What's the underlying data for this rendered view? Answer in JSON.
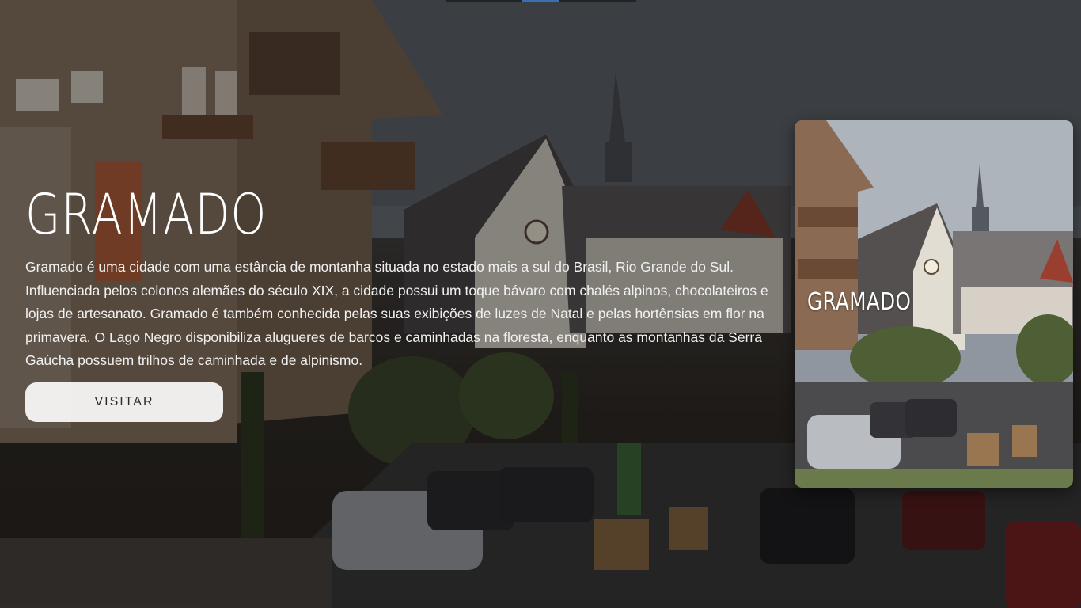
{
  "hero": {
    "title": "GRAMADO",
    "description": "Gramado é uma cidade com uma estância de montanha situada no estado mais a sul do Brasil, Rio Grande do Sul. Influenciada pelos colonos alemães do século XIX, a cidade possui um toque bávaro com chalés alpinos, chocolateiros e lojas de artesanato. Gramado é também conhecida pelas suas exibições de luzes de Natal e pelas hortênsias em flor na primavera. O Lago Negro disponibiliza alugueres de barcos e caminhadas na floresta, enquanto as montanhas da Serra Gaúcha possuem trilhos de caminhada e de alpinismo.",
    "button_label": "VISITAR"
  },
  "cards": [
    {
      "title": "GRAMADO"
    }
  ],
  "colors": {
    "indicator_active": "#3a6fb5",
    "button_bg": "#ffffff",
    "text": "#ffffff"
  }
}
